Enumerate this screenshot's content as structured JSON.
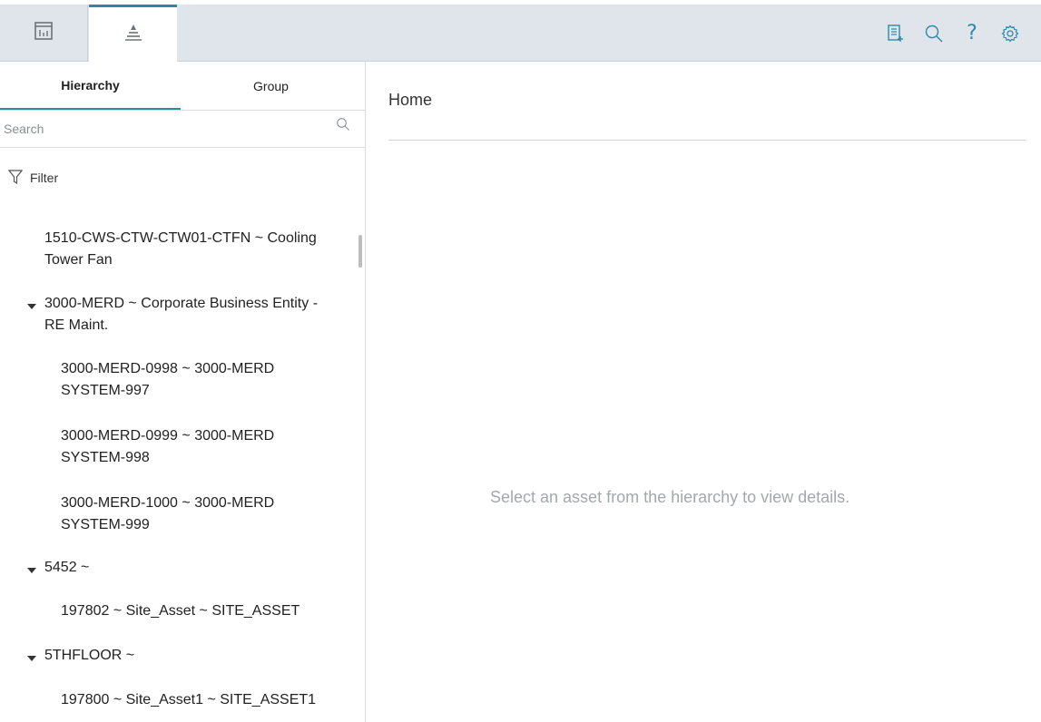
{
  "topbar": {
    "tabs": [
      {
        "icon": "dashboard-icon"
      },
      {
        "icon": "hierarchy-icon"
      }
    ],
    "actions": [
      {
        "icon": "add-report-icon"
      },
      {
        "icon": "search-icon"
      },
      {
        "icon": "help-icon",
        "glyph": "?"
      },
      {
        "icon": "settings-icon"
      }
    ],
    "accent_color": "#2d8aa8"
  },
  "sidebar": {
    "tabs": [
      {
        "label": "Hierarchy",
        "active": true
      },
      {
        "label": "Group",
        "active": false
      }
    ],
    "search": {
      "placeholder": "Search",
      "value": ""
    },
    "filter_label": "Filter",
    "tree": [
      {
        "line1": "1510-CWS-CTW-CTW01-CTFN ~ Cooling",
        "line2": "Tower Fan",
        "expanded": null,
        "level": 1
      },
      {
        "line1": "3000-MERD ~ Corporate Business Entity -",
        "line2": "RE Maint.",
        "expanded": true,
        "level": 1
      },
      {
        "line1": "3000-MERD-0998 ~ 3000-MERD",
        "line2": "SYSTEM-997",
        "expanded": null,
        "level": 2
      },
      {
        "line1": "3000-MERD-0999 ~ 3000-MERD",
        "line2": "SYSTEM-998",
        "expanded": null,
        "level": 2
      },
      {
        "line1": "3000-MERD-1000 ~ 3000-MERD",
        "line2": "SYSTEM-999",
        "expanded": null,
        "level": 2
      },
      {
        "line1": "5452 ~",
        "line2": "",
        "expanded": true,
        "level": 1
      },
      {
        "line1": "197802 ~ Site_Asset ~ SITE_ASSET",
        "line2": "",
        "expanded": null,
        "level": 2
      },
      {
        "line1": "5THFLOOR ~",
        "line2": "",
        "expanded": true,
        "level": 1
      },
      {
        "line1": "197800 ~ Site_Asset1 ~ SITE_ASSET1",
        "line2": "",
        "expanded": null,
        "level": 2
      }
    ]
  },
  "main": {
    "title": "Home",
    "empty_message": "Select an asset from the hierarchy to view details."
  }
}
